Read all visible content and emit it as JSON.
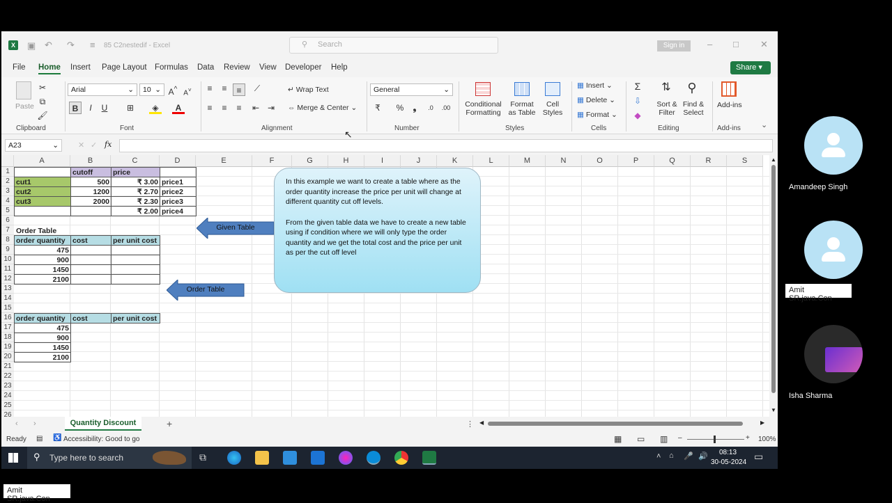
{
  "excel": {
    "file_title": "85 C2nestedif - Excel",
    "search_placeholder": "Search",
    "signin": "Sign in",
    "share": "Share",
    "menu": [
      "File",
      "Home",
      "Insert",
      "Page Layout",
      "Formulas",
      "Data",
      "Review",
      "View",
      "Developer",
      "Help"
    ],
    "ribbon": {
      "clipboard": "Clipboard",
      "paste": "Paste",
      "font": "Font",
      "font_name": "Arial",
      "font_size": "10",
      "alignment": "Alignment",
      "wrap_text": "Wrap Text",
      "merge_center": "Merge & Center",
      "number": "Number",
      "number_format": "General",
      "styles": "Styles",
      "conditional": "Conditional Formatting",
      "format_table": "Format as Table",
      "cell_styles": "Cell Styles",
      "cells": "Cells",
      "insert": "Insert",
      "delete": "Delete",
      "format": "Format",
      "editing": "Editing",
      "sort_filter": "Sort & Filter",
      "find_select": "Find & Select",
      "addins_group": "Add-ins",
      "addins": "Add-ins"
    },
    "name_box": "A23",
    "columns": [
      "A",
      "B",
      "C",
      "D",
      "E",
      "F",
      "G",
      "H",
      "I",
      "J",
      "K",
      "L",
      "M",
      "N",
      "O",
      "P",
      "Q",
      "R",
      "S"
    ],
    "rows": [
      "1",
      "2",
      "3",
      "4",
      "5",
      "6",
      "7",
      "8",
      "9",
      "10",
      "11",
      "12",
      "13",
      "14",
      "15",
      "16",
      "17",
      "18",
      "19",
      "20",
      "21",
      "22",
      "23",
      "24",
      "25",
      "26"
    ],
    "given_table": {
      "header": [
        "",
        "cutoff",
        "price",
        ""
      ],
      "rows": [
        [
          "cut1",
          "500",
          "₹ 3.00",
          "price1"
        ],
        [
          "cut2",
          "1200",
          "₹ 2.70",
          "price2"
        ],
        [
          "cut3",
          "2000",
          "₹ 2.30",
          "price3"
        ],
        [
          "",
          "",
          "₹ 2.00",
          "price4"
        ]
      ]
    },
    "order_table_title": "Order Table",
    "order_header": [
      "order quantity",
      "cost",
      "per unit cost"
    ],
    "order_values": [
      "475",
      "900",
      "1450",
      "2100"
    ],
    "arrow_given": "Given Table",
    "arrow_order": "Order Table",
    "callout_p1": "In this example we  want to  create  a  table where  as  the  order quantity  increase  the price per unit  will change at different  quantity cut off levels.",
    "callout_p2": "From the given table  data we have to create a new table using  if condition where we  will only  type the order quantity and we get the  total cost and the price per unit as per the cut off level",
    "sheet_tab": "Quantity Discount",
    "status_ready": "Ready",
    "accessibility": "Accessibility: Good to go",
    "zoom": "100%"
  },
  "taskbar": {
    "search": "Type here to search",
    "time": "08:13",
    "date": "30-05-2024"
  },
  "participants": [
    "Amandeep Singh",
    "Amit SR.java.Con",
    "Isha Sharma"
  ],
  "bottom_label": "Amit SR.java.Con",
  "colors": {
    "excel_green": "#1f7a43",
    "cut_green": "#a7c86a",
    "purple": "#c9bee0",
    "teal": "#b6dde4",
    "arrow_blue": "#4f7fbf"
  }
}
